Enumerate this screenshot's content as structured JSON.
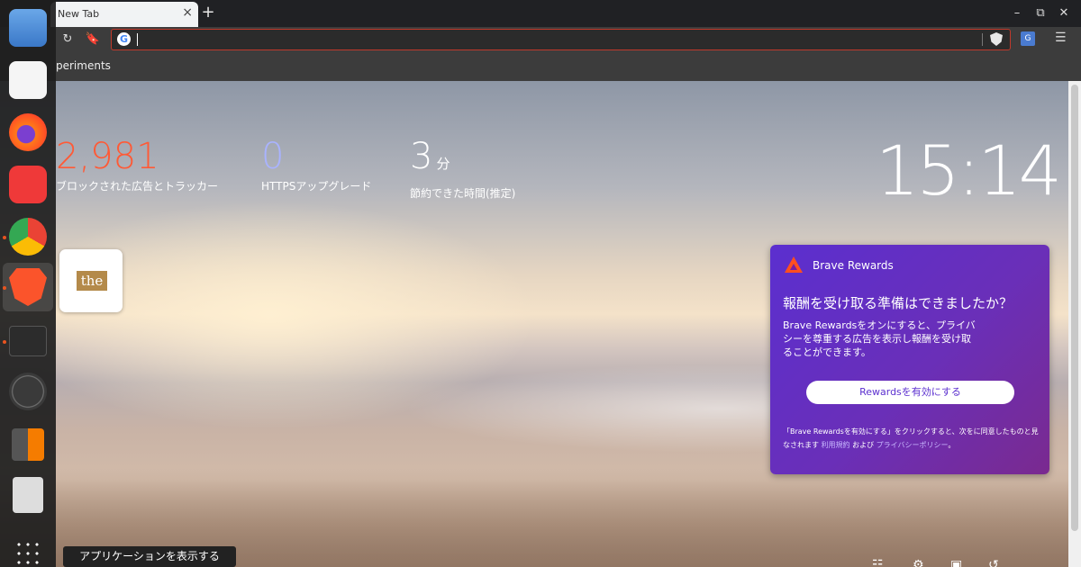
{
  "browser": {
    "tab_title": "New Tab",
    "tab_close": "×",
    "new_tab": "+",
    "bookmark_item": "periments",
    "window_min": "–",
    "window_max": "⧉",
    "window_close": "✕"
  },
  "stats": {
    "blocked": {
      "value": "2,981",
      "label": "ブロックされた広告とトラッカー",
      "color": "#ff5a36"
    },
    "https": {
      "value": "0",
      "label": "HTTPSアップグレード",
      "color": "#a9b3ff"
    },
    "time": {
      "value": "3",
      "unit": "分",
      "label": "節約できた時間(推定)"
    }
  },
  "clock": "15:14",
  "tile": {
    "logo": "the"
  },
  "rewards": {
    "title": "Brave Rewards",
    "heading": "報酬を受け取る準備はできましたか？",
    "body": "Brave Rewardsをオンにすると、プライバシーを尊重する広告を表示し報酬を受け取ることができます。",
    "button": "Rewardsを有効にする",
    "footer_prefix": "「Brave Rewardsを有効にする」をクリックすると、次をに同意したものと見なされます",
    "terms_link": "利用規約",
    "and": "および",
    "privacy_link": "プライバシーポリシー",
    "footer_suffix": "。"
  },
  "dock": {
    "tooltip": "アプリケーションを表示する",
    "apps": [
      "files",
      "text-editor",
      "firefox",
      "vivaldi",
      "chrome",
      "brave",
      "terminal",
      "clock",
      "calculator",
      "trash",
      "app-grid"
    ]
  }
}
